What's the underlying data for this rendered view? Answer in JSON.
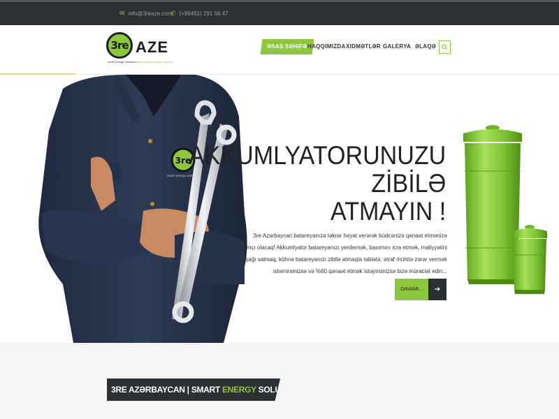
{
  "topbar": {
    "email": "info@3reaze.com",
    "phone": "(+99451) 291 58 47"
  },
  "logo": {
    "mark": "3re",
    "word": "AZE",
    "tagline_left": "smart energy solutions",
    "tagline_right": "akkumulyator bərpası mərkəzi"
  },
  "nav": {
    "items": [
      {
        "label": "Əsas səhifə",
        "active": true
      },
      {
        "label": "Haqqımızda",
        "active": false
      },
      {
        "label": "Xidmətlər",
        "active": false
      },
      {
        "label": "Galerya",
        "active": false
      },
      {
        "label": "Əlaqə",
        "active": false
      }
    ]
  },
  "hero": {
    "title_line1": "AKKUMLYATORUNUZU",
    "title_line2": "ZİBİLƏ",
    "title_line3": "ATMAYIN !",
    "text": "3re Azərbaycan batareyanıza təkrar həyat verərək büdcənizə qənaət etmənizə yardımçı olacaq! Akkumlyator batareyanızı yenilemək, baxımını icra etmək, maliyyətini aşağı salmaq, köhnə batareyanızı zibilə atmaqla təbiətə, ətraf mühitə zərər vermək istəmirsinizsə və %60 qənaət etmək istəyirsinizsə bizə müraciət edin...",
    "button_label": "DAVAMI...",
    "badge_text": "3re",
    "badge_sub": "smart energy solutions"
  },
  "section": {
    "banner_part1": "3RE AZƏRBAYCAN | SMART ",
    "banner_part2": "ENERGY",
    "banner_part3": " SOLUTIONS"
  },
  "colors": {
    "accent": "#8dc63f",
    "dark": "#2b3032",
    "topbar": "#2b3032"
  }
}
